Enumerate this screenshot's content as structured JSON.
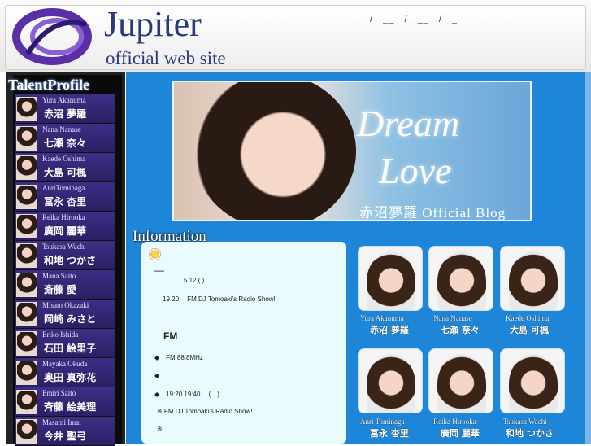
{
  "header": {
    "title": "Jupiter",
    "subtitle": "official web site",
    "nav": [
      "/",
      "__",
      "/",
      "__",
      "/",
      "_"
    ]
  },
  "sidebar": {
    "heading": "TalentProfile",
    "talents": [
      {
        "en": "Yura Akanuma",
        "jp": "赤沼 夢羅"
      },
      {
        "en": "Nana Nanase",
        "jp": "七瀬 奈々"
      },
      {
        "en": "Kaede Oshima",
        "jp": "大島 可楓"
      },
      {
        "en": "AnriTominaga",
        "jp": "冨永 杏里"
      },
      {
        "en": "Reika Hirooka",
        "jp": "廣岡 麗華"
      },
      {
        "en": "Tsukasa Wachi",
        "jp": "和地 つかさ"
      },
      {
        "en": "Mana Saito",
        "jp": "斎藤 愛"
      },
      {
        "en": "Misato Okazaki",
        "jp": "岡崎 みさと"
      },
      {
        "en": "Eriko Ishida",
        "jp": "石田 絵里子"
      },
      {
        "en": "Mayaka Okuda",
        "jp": "奥田 真弥花"
      },
      {
        "en": "Emiri Saito",
        "jp": "斉藤 絵美理"
      },
      {
        "en": "Masami Imai",
        "jp": "今井 聖弓"
      }
    ]
  },
  "banner": {
    "line1": "Dream",
    "line2": "Love",
    "blog": "赤沼夢羅 Official Blog"
  },
  "information": {
    "heading": "Information",
    "lines": [
      "—",
      "5 12 ( )",
      "19 20 　FM DJ Tomoaki's Radio Show!",
      "FM",
      "◆　FM 88.8MHz",
      "◆",
      "◆　19:20 19:40 　(　)",
      "※ FM DJ Tomoaki's Radio Show!",
      "※"
    ]
  },
  "gallery": [
    {
      "en": "Yura Akanuma",
      "jp": "赤沼 夢羅"
    },
    {
      "en": "Nana Nanase",
      "jp": "七瀬 奈々"
    },
    {
      "en": "Kaede Oshima",
      "jp": "大島 可楓"
    },
    {
      "en": "Anri Tominaga",
      "jp": "冨永 杏里"
    },
    {
      "en": "Reika Hirooka",
      "jp": "廣岡 麗華"
    },
    {
      "en": "Tsukasa Wachi",
      "jp": "和地 つかさ"
    }
  ],
  "colors": {
    "main_bg": "#1e86d8",
    "sidebar_bg": "#0a0a0a",
    "title": "#2a3a78"
  }
}
